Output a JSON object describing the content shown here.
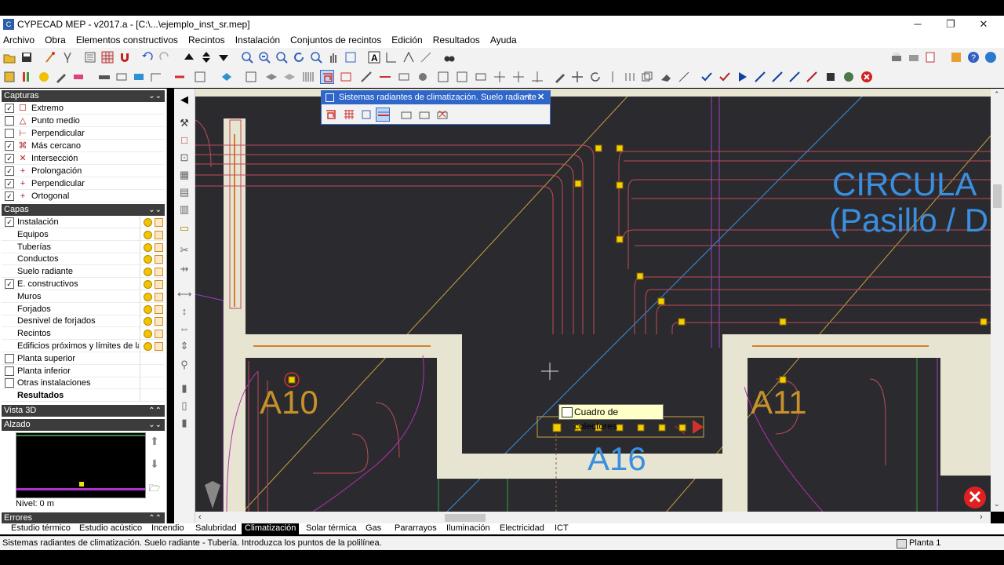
{
  "window": {
    "title": "CYPECAD MEP - v2017.a - [C:\\...\\ejemplo_inst_sr.mep]",
    "icon": "app-icon",
    "controls": [
      "─",
      "❐",
      "✕"
    ]
  },
  "menu": [
    "Archivo",
    "Obra",
    "Elementos constructivos",
    "Recintos",
    "Instalación",
    "Conjuntos de recintos",
    "Edición",
    "Resultados",
    "Ayuda"
  ],
  "left_panel": {
    "capturas": {
      "title": "Capturas",
      "items": [
        {
          "label": "Extremo",
          "checked": true,
          "icon": "☐"
        },
        {
          "label": "Punto medio",
          "checked": false,
          "icon": "△"
        },
        {
          "label": "Perpendicular",
          "checked": false,
          "icon": "⊢"
        },
        {
          "label": "Más cercano",
          "checked": true,
          "icon": "⌘"
        },
        {
          "label": "Intersección",
          "checked": true,
          "icon": "✕"
        },
        {
          "label": "Prolongación",
          "checked": true,
          "icon": "+"
        },
        {
          "label": "Perpendicular",
          "checked": true,
          "icon": "+"
        },
        {
          "label": "Ortogonal",
          "checked": true,
          "icon": "+"
        }
      ]
    },
    "capas": {
      "title": "Capas",
      "items": [
        {
          "label": "Instalación",
          "checked": true,
          "checkbox": true
        },
        {
          "label": "Equipos",
          "checkbox": false
        },
        {
          "label": "Tuberías",
          "checkbox": false
        },
        {
          "label": "Conductos",
          "checkbox": false
        },
        {
          "label": "Suelo radiante",
          "checkbox": false
        },
        {
          "label": "E. constructivos",
          "checked": true,
          "checkbox": true
        },
        {
          "label": "Muros",
          "checkbox": false
        },
        {
          "label": "Forjados",
          "checkbox": false
        },
        {
          "label": "Desnivel de forjados",
          "checkbox": false
        },
        {
          "label": "Recintos",
          "checkbox": false
        },
        {
          "label": "Edificios próximos y límites de la ...",
          "checkbox": false
        },
        {
          "label": "Planta superior",
          "checked": false,
          "checkbox": true,
          "nolayer": true
        },
        {
          "label": "Planta inferior",
          "checked": false,
          "checkbox": true,
          "nolayer": true
        },
        {
          "label": "Otras instalaciones",
          "checked": false,
          "checkbox": true,
          "nolayer": true
        },
        {
          "label": "Resultados",
          "bold": true,
          "nolayer": true
        }
      ]
    },
    "vista3d": {
      "title": "Vista 3D"
    },
    "alzado": {
      "title": "Alzado",
      "nivel": "Nivel: 0 m"
    },
    "errores": {
      "title": "Errores"
    }
  },
  "subwindow": {
    "title": "Sistemas radiantes de climatización. Suelo radiante",
    "pin": "⊣",
    "close": "✕"
  },
  "canvas": {
    "rooms": [
      "A10",
      "A11",
      "A16"
    ],
    "circulation": [
      "CIRCULA",
      "(Pasillo / D"
    ],
    "tooltip": "Cuadro de colectores"
  },
  "tabs": [
    "Estudio térmico",
    "Estudio acústico",
    "Incendio",
    "Salubridad",
    "Climatización",
    "Solar térmica",
    "Gas",
    "Pararrayos",
    "Iluminación",
    "Electricidad",
    "ICT"
  ],
  "active_tab": "Climatización",
  "status": {
    "message": "Sistemas radiantes de climatización. Suelo radiante - Tubería.  Introduzca los puntos de la polilínea.",
    "floor": "Planta 1"
  },
  "colors": {
    "canvas_bg": "#2b2b2f",
    "wall": "#e8e4d2",
    "room_label": "#c8922a",
    "circ_label": "#3a8fe0",
    "pipe": "#c04a5a",
    "node": "#f0d000",
    "accent": "#2e66c9"
  }
}
